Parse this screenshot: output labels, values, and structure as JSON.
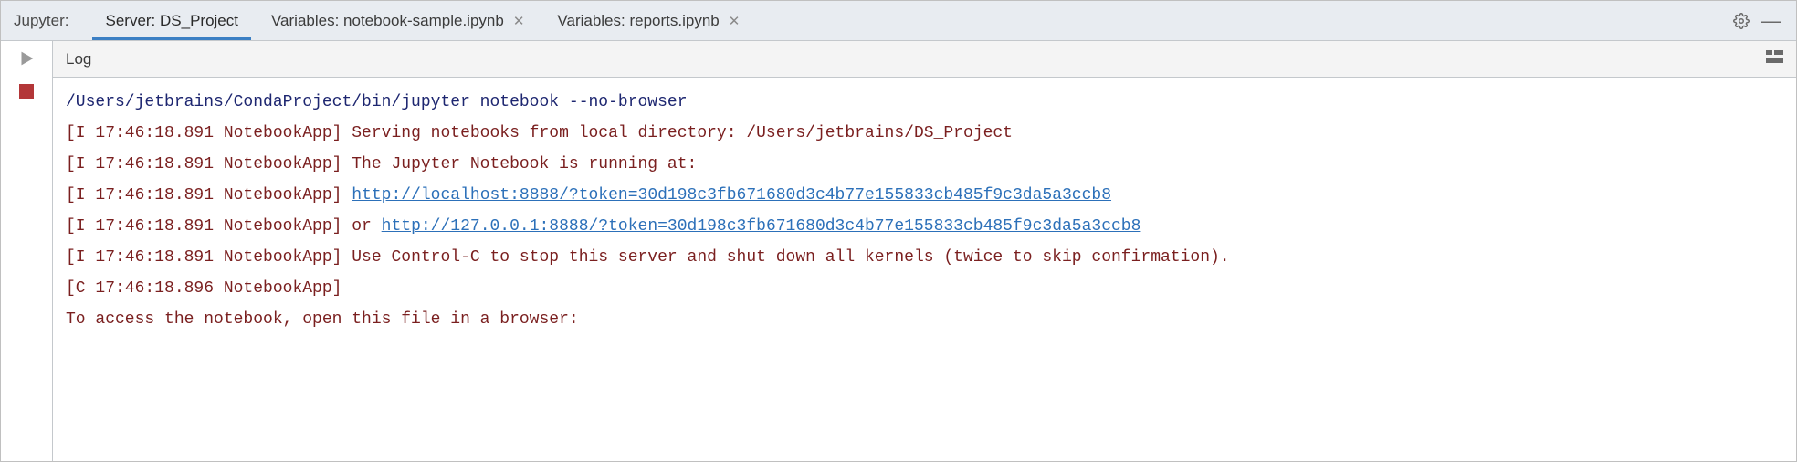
{
  "windowLabel": "Jupyter:",
  "tabs": [
    {
      "label": "Server: DS_Project",
      "closable": false,
      "active": true
    },
    {
      "label": "Variables: notebook-sample.ipynb",
      "closable": true,
      "active": false
    },
    {
      "label": "Variables: reports.ipynb",
      "closable": true,
      "active": false
    }
  ],
  "logTitle": "Log",
  "log": {
    "command": "/Users/jetbrains/CondaProject/bin/jupyter notebook --no-browser",
    "prefix1": "[I 17:46:18.891 NotebookApp]",
    "prefix2": "[C 17:46:18.896 NotebookApp]",
    "msg_serving": " Serving notebooks from local directory: /Users/jetbrains/DS_Project",
    "msg_running": " The Jupyter Notebook is running at:",
    "url1": "http://localhost:8888/?token=30d198c3fb671680d3c4b77e155833cb485f9c3da5a3ccb8",
    "or_text": "  or ",
    "url2": "http://127.0.0.1:8888/?token=30d198c3fb671680d3c4b77e155833cb485f9c3da5a3ccb8",
    "msg_ctrl_c": " Use Control-C to stop this server and shut down all kernels (twice to skip confirmation).",
    "blank": "",
    "msg_access": "    To access the notebook, open this file in a browser:"
  }
}
